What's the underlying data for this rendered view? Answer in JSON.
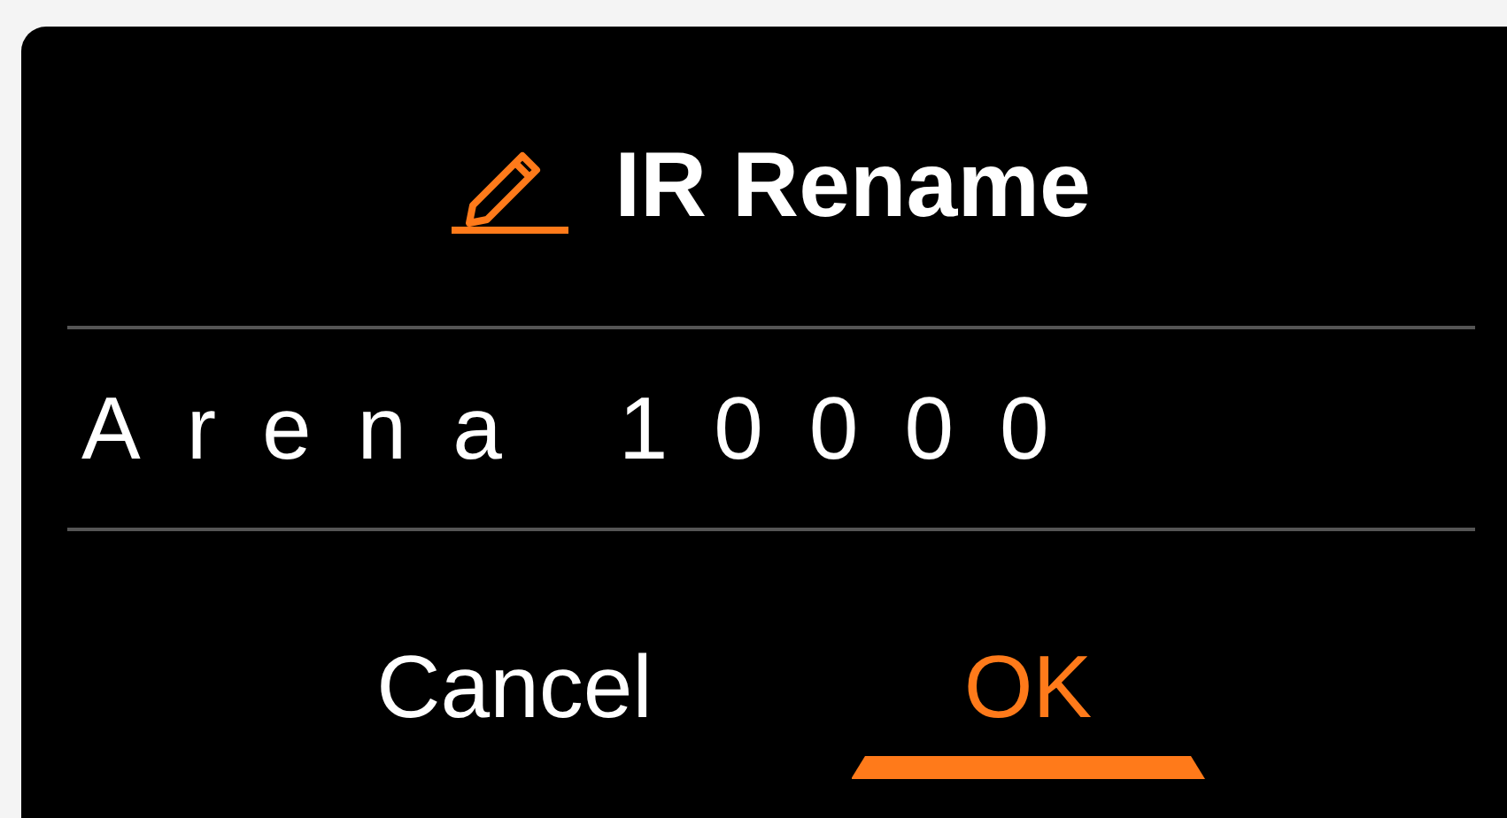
{
  "dialog": {
    "title": "IR Rename",
    "field": {
      "value": "Arena 10000"
    },
    "buttons": [
      {
        "label": "Cancel",
        "selected": false
      },
      {
        "label": "OK",
        "selected": true
      }
    ]
  }
}
